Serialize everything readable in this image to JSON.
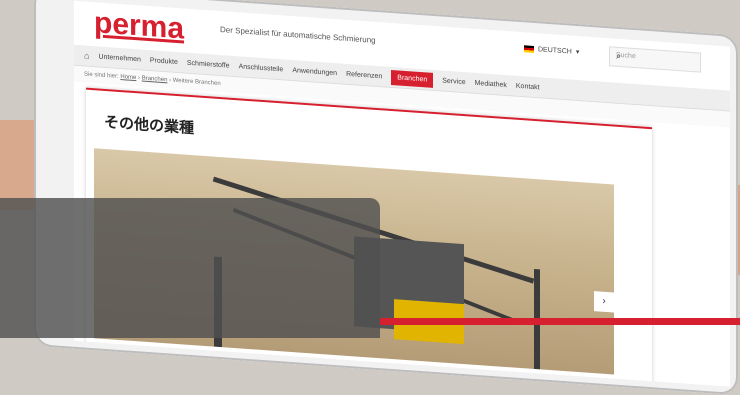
{
  "header": {
    "logo": "perma",
    "slogan": "Der Spezialist für automatische Schmierung",
    "language": "DEUTSCH",
    "search_placeholder": "Suche"
  },
  "nav": {
    "items": [
      "Unternehmen",
      "Produkte",
      "Schmierstoffe",
      "Anschlussteile",
      "Anwendungen",
      "Referenzen",
      "Branchen",
      "Service",
      "Mediathek",
      "Kontakt"
    ],
    "active": "Branchen"
  },
  "breadcrumb": {
    "prefix": "Sie sind hier:",
    "home": "Home",
    "branchen": "Branchen",
    "current": "Weitere Branchen"
  },
  "content": {
    "title": "その他の業種"
  },
  "colors": {
    "brand_red": "#d7202f",
    "overlay": "#505050"
  }
}
